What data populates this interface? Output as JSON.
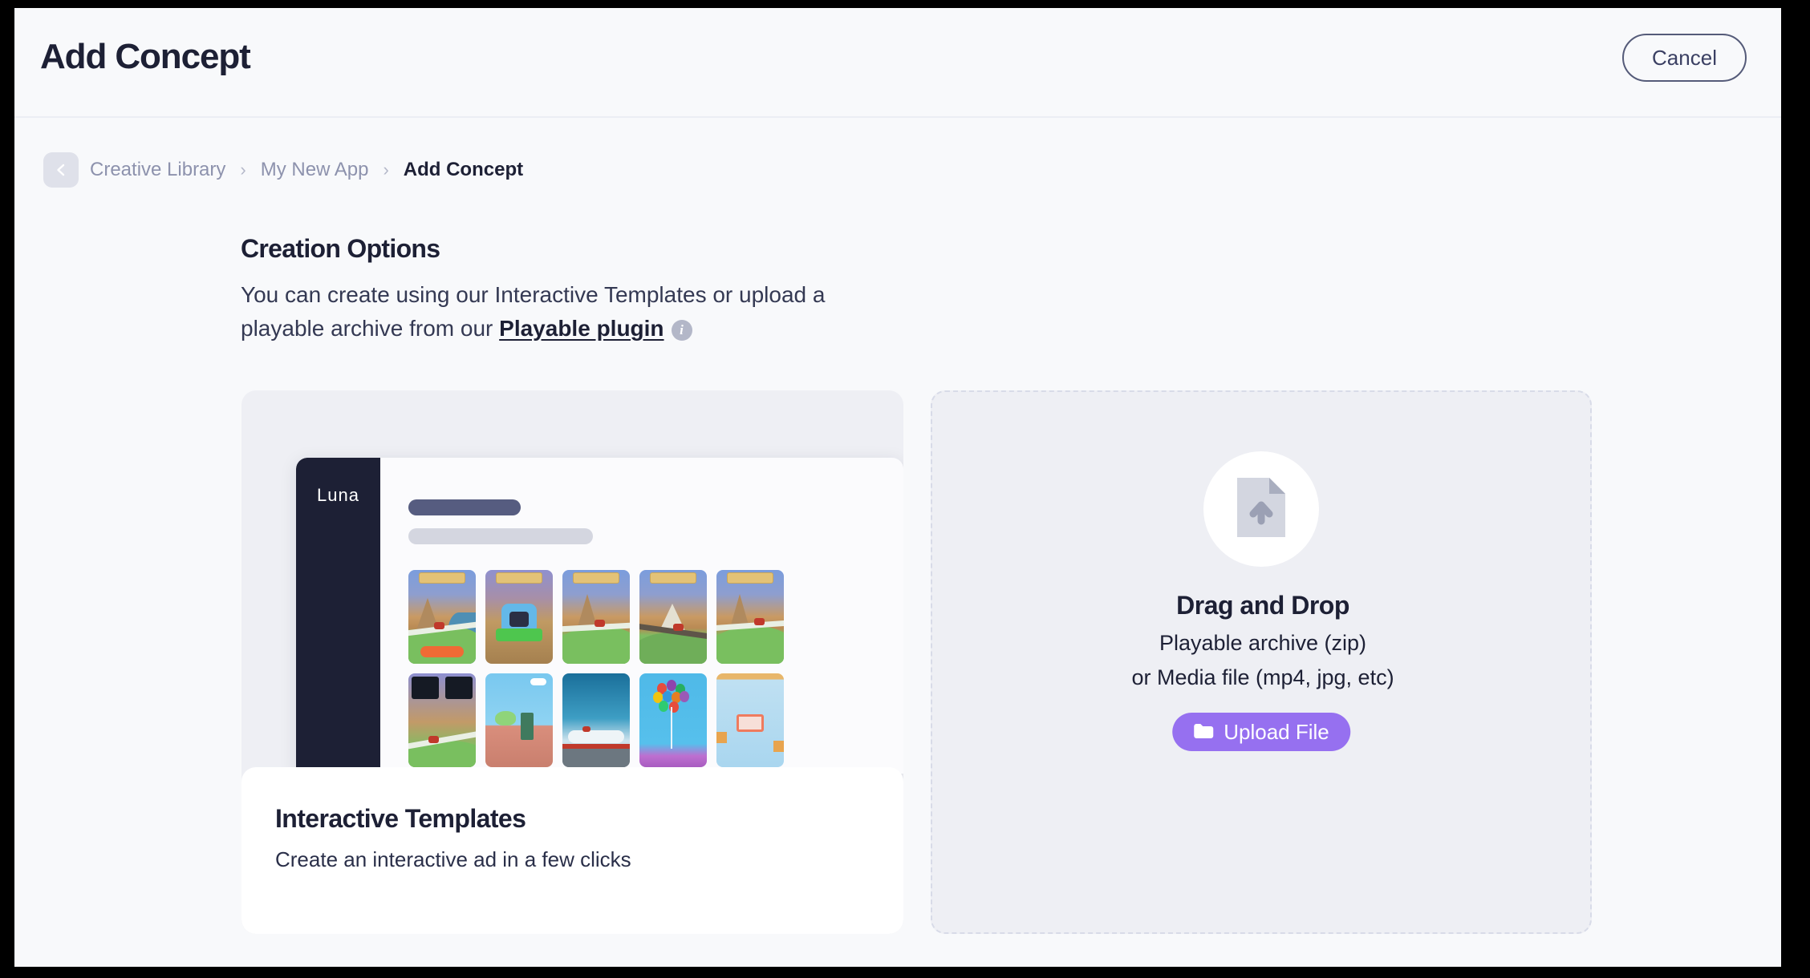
{
  "header": {
    "title": "Add Concept",
    "cancel_label": "Cancel"
  },
  "breadcrumb": {
    "back_icon": "chevron-left-icon",
    "items": [
      {
        "label": "Creative Library",
        "current": false
      },
      {
        "label": "My New App",
        "current": false
      },
      {
        "label": "Add Concept",
        "current": true
      }
    ],
    "separator": "›"
  },
  "creation_options": {
    "heading": "Creation Options",
    "description_part1": "You can create using our Interactive Templates or upload a playable archive from our ",
    "link_label": "Playable plugin",
    "info_icon": "info-icon",
    "info_glyph": "i"
  },
  "interactive_templates_card": {
    "title": "Interactive Templates",
    "subtitle": "Create an interactive ad in a few clicks",
    "preview": {
      "logo": "Luna",
      "thumbnails": [
        {
          "name": "hill-climb-racer"
        },
        {
          "name": "desert-icon-cta"
        },
        {
          "name": "mountain-racer"
        },
        {
          "name": "dune-racer"
        },
        {
          "name": "valley-racer"
        },
        {
          "name": "dual-choice-racer"
        },
        {
          "name": "dino-platformer"
        },
        {
          "name": "sky-dive"
        },
        {
          "name": "balloon-pop"
        },
        {
          "name": "basketball-shot"
        }
      ]
    }
  },
  "drag_drop_zone": {
    "upload_icon": "file-upload-icon",
    "title": "Drag and Drop",
    "line1": "Playable archive (zip)",
    "line2": "or Media file (mp4, jpg, etc)",
    "upload_button_label": "Upload File",
    "upload_button_icon": "folder-icon"
  },
  "colors": {
    "accent_purple": "#9670f0",
    "page_background": "#f8f9fb",
    "card_background": "#eeeff4",
    "text_dark": "#1d2035",
    "text_muted": "#8d92ad"
  }
}
